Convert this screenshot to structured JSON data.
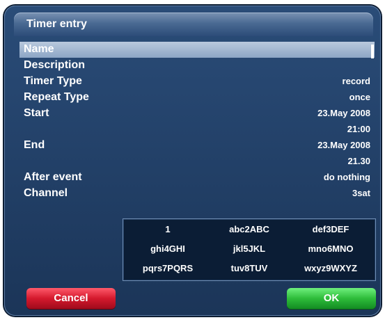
{
  "window": {
    "title": "Timer entry"
  },
  "form": {
    "rows": [
      {
        "label": "Name",
        "value": ""
      },
      {
        "label": "Description",
        "value": ""
      },
      {
        "label": "Timer Type",
        "value": "record"
      },
      {
        "label": "Repeat Type",
        "value": "once"
      },
      {
        "label": "Start",
        "value": "23.May 2008"
      },
      {
        "label": "",
        "value": "21:00"
      },
      {
        "label": "End",
        "value": "23.May 2008"
      },
      {
        "label": "",
        "value": "21.30"
      },
      {
        "label": "After event",
        "value": "do nothing"
      },
      {
        "label": "Channel",
        "value": "3sat"
      }
    ]
  },
  "keypad": {
    "keys": [
      [
        "1",
        "abc2ABC",
        "def3DEF"
      ],
      [
        "ghi4GHI",
        "jkl5JKL",
        "mno6MNO"
      ],
      [
        "pqrs7PQRS",
        "tuv8TUV",
        "wxyz9WXYZ"
      ]
    ]
  },
  "buttons": {
    "cancel": "Cancel",
    "ok": "OK"
  }
}
